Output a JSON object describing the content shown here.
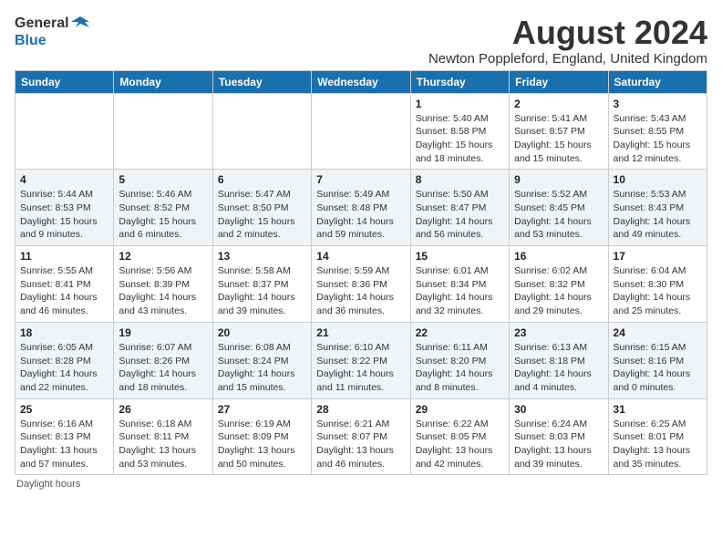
{
  "header": {
    "logo_line1": "General",
    "logo_line2": "Blue",
    "title": "August 2024",
    "location": "Newton Poppleford, England, United Kingdom"
  },
  "days_of_week": [
    "Sunday",
    "Monday",
    "Tuesday",
    "Wednesday",
    "Thursday",
    "Friday",
    "Saturday"
  ],
  "footer": "Daylight hours",
  "weeks": [
    [
      {
        "day": "",
        "info": ""
      },
      {
        "day": "",
        "info": ""
      },
      {
        "day": "",
        "info": ""
      },
      {
        "day": "",
        "info": ""
      },
      {
        "day": "1",
        "info": "Sunrise: 5:40 AM\nSunset: 8:58 PM\nDaylight: 15 hours\nand 18 minutes."
      },
      {
        "day": "2",
        "info": "Sunrise: 5:41 AM\nSunset: 8:57 PM\nDaylight: 15 hours\nand 15 minutes."
      },
      {
        "day": "3",
        "info": "Sunrise: 5:43 AM\nSunset: 8:55 PM\nDaylight: 15 hours\nand 12 minutes."
      }
    ],
    [
      {
        "day": "4",
        "info": "Sunrise: 5:44 AM\nSunset: 8:53 PM\nDaylight: 15 hours\nand 9 minutes."
      },
      {
        "day": "5",
        "info": "Sunrise: 5:46 AM\nSunset: 8:52 PM\nDaylight: 15 hours\nand 6 minutes."
      },
      {
        "day": "6",
        "info": "Sunrise: 5:47 AM\nSunset: 8:50 PM\nDaylight: 15 hours\nand 2 minutes."
      },
      {
        "day": "7",
        "info": "Sunrise: 5:49 AM\nSunset: 8:48 PM\nDaylight: 14 hours\nand 59 minutes."
      },
      {
        "day": "8",
        "info": "Sunrise: 5:50 AM\nSunset: 8:47 PM\nDaylight: 14 hours\nand 56 minutes."
      },
      {
        "day": "9",
        "info": "Sunrise: 5:52 AM\nSunset: 8:45 PM\nDaylight: 14 hours\nand 53 minutes."
      },
      {
        "day": "10",
        "info": "Sunrise: 5:53 AM\nSunset: 8:43 PM\nDaylight: 14 hours\nand 49 minutes."
      }
    ],
    [
      {
        "day": "11",
        "info": "Sunrise: 5:55 AM\nSunset: 8:41 PM\nDaylight: 14 hours\nand 46 minutes."
      },
      {
        "day": "12",
        "info": "Sunrise: 5:56 AM\nSunset: 8:39 PM\nDaylight: 14 hours\nand 43 minutes."
      },
      {
        "day": "13",
        "info": "Sunrise: 5:58 AM\nSunset: 8:37 PM\nDaylight: 14 hours\nand 39 minutes."
      },
      {
        "day": "14",
        "info": "Sunrise: 5:59 AM\nSunset: 8:36 PM\nDaylight: 14 hours\nand 36 minutes."
      },
      {
        "day": "15",
        "info": "Sunrise: 6:01 AM\nSunset: 8:34 PM\nDaylight: 14 hours\nand 32 minutes."
      },
      {
        "day": "16",
        "info": "Sunrise: 6:02 AM\nSunset: 8:32 PM\nDaylight: 14 hours\nand 29 minutes."
      },
      {
        "day": "17",
        "info": "Sunrise: 6:04 AM\nSunset: 8:30 PM\nDaylight: 14 hours\nand 25 minutes."
      }
    ],
    [
      {
        "day": "18",
        "info": "Sunrise: 6:05 AM\nSunset: 8:28 PM\nDaylight: 14 hours\nand 22 minutes."
      },
      {
        "day": "19",
        "info": "Sunrise: 6:07 AM\nSunset: 8:26 PM\nDaylight: 14 hours\nand 18 minutes."
      },
      {
        "day": "20",
        "info": "Sunrise: 6:08 AM\nSunset: 8:24 PM\nDaylight: 14 hours\nand 15 minutes."
      },
      {
        "day": "21",
        "info": "Sunrise: 6:10 AM\nSunset: 8:22 PM\nDaylight: 14 hours\nand 11 minutes."
      },
      {
        "day": "22",
        "info": "Sunrise: 6:11 AM\nSunset: 8:20 PM\nDaylight: 14 hours\nand 8 minutes."
      },
      {
        "day": "23",
        "info": "Sunrise: 6:13 AM\nSunset: 8:18 PM\nDaylight: 14 hours\nand 4 minutes."
      },
      {
        "day": "24",
        "info": "Sunrise: 6:15 AM\nSunset: 8:16 PM\nDaylight: 14 hours\nand 0 minutes."
      }
    ],
    [
      {
        "day": "25",
        "info": "Sunrise: 6:16 AM\nSunset: 8:13 PM\nDaylight: 13 hours\nand 57 minutes."
      },
      {
        "day": "26",
        "info": "Sunrise: 6:18 AM\nSunset: 8:11 PM\nDaylight: 13 hours\nand 53 minutes."
      },
      {
        "day": "27",
        "info": "Sunrise: 6:19 AM\nSunset: 8:09 PM\nDaylight: 13 hours\nand 50 minutes."
      },
      {
        "day": "28",
        "info": "Sunrise: 6:21 AM\nSunset: 8:07 PM\nDaylight: 13 hours\nand 46 minutes."
      },
      {
        "day": "29",
        "info": "Sunrise: 6:22 AM\nSunset: 8:05 PM\nDaylight: 13 hours\nand 42 minutes."
      },
      {
        "day": "30",
        "info": "Sunrise: 6:24 AM\nSunset: 8:03 PM\nDaylight: 13 hours\nand 39 minutes."
      },
      {
        "day": "31",
        "info": "Sunrise: 6:25 AM\nSunset: 8:01 PM\nDaylight: 13 hours\nand 35 minutes."
      }
    ]
  ]
}
